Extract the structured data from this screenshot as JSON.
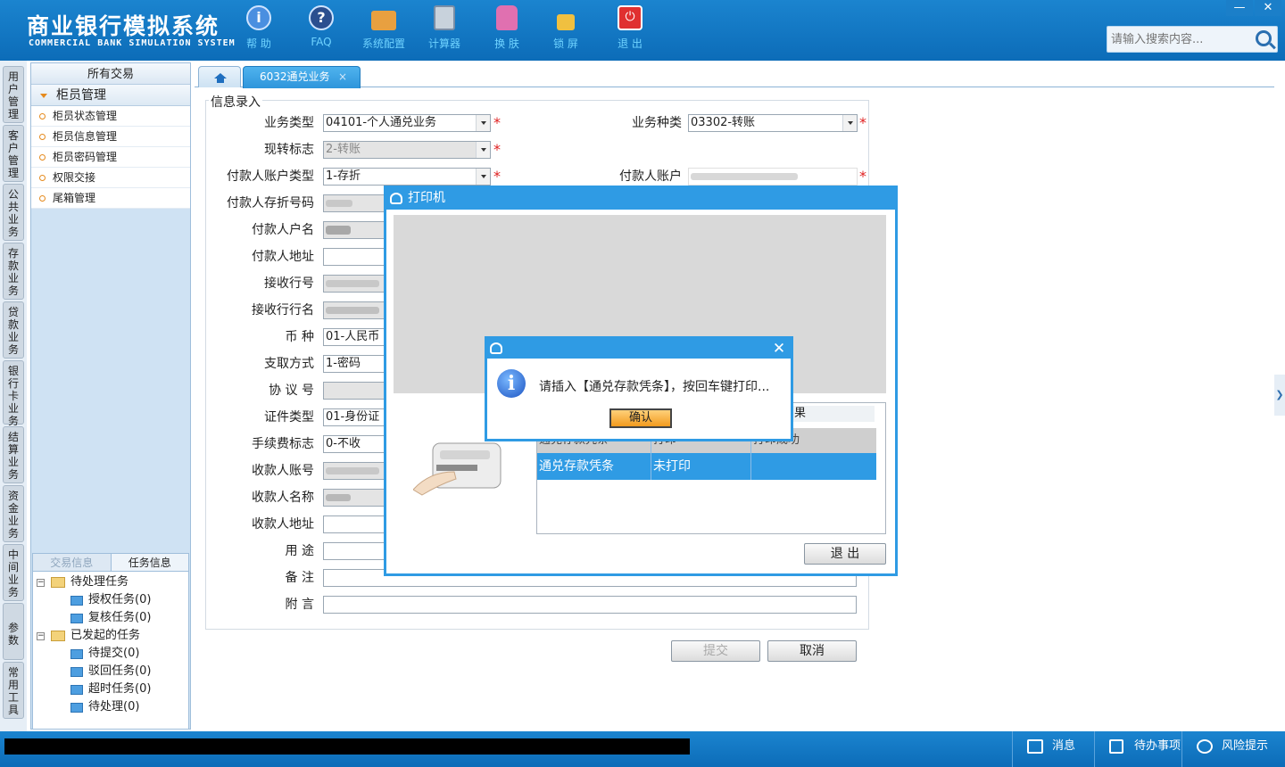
{
  "header": {
    "title_cn": "商业银行模拟系统",
    "title_en": "COMMERCIAL BANK SIMULATION SYSTEM",
    "tools": [
      {
        "label": "帮 助",
        "icon": "help-icon",
        "color": "#4a8fe0"
      },
      {
        "label": "FAQ",
        "icon": "faq-icon",
        "color": "#2b4f8f"
      },
      {
        "label": "系统配置",
        "icon": "toolbox-icon",
        "color": "#e8a040"
      },
      {
        "label": "计算器",
        "icon": "calculator-icon",
        "color": "#7a8ea6"
      },
      {
        "label": "换 肤",
        "icon": "shirt-icon",
        "color": "#e070b0"
      },
      {
        "label": "锁 屏",
        "icon": "lock-icon",
        "color": "#f0c040"
      },
      {
        "label": "退 出",
        "icon": "power-icon",
        "color": "#e03030"
      }
    ],
    "minimize": "—",
    "close": "✕",
    "search_placeholder": "请输入搜索内容..."
  },
  "left_tabs": [
    "用户管理",
    "客户管理",
    "公共业务",
    "存款业务",
    "贷款业务",
    "银行卡业务",
    "结算业务",
    "资金业务",
    "中间业务",
    "参数",
    "常用工具"
  ],
  "nav": {
    "header": "所有交易",
    "group": "柜员管理",
    "items": [
      "柜员状态管理",
      "柜员信息管理",
      "柜员密码管理",
      "权限交接",
      "尾箱管理"
    ]
  },
  "tasks": {
    "tab_trade": "交易信息",
    "tab_task": "任务信息",
    "pending": "待处理任务",
    "pending_children": [
      "授权任务(0)",
      "复核任务(0)"
    ],
    "initiated": "已发起的任务",
    "initiated_children": [
      "待提交(0)",
      "驳回任务(0)",
      "超时任务(0)",
      "待处理(0)"
    ]
  },
  "tabs": {
    "home_icon": "home-icon",
    "active": "6032通兑业务",
    "active_close": "×"
  },
  "form": {
    "legend": "信息录入",
    "biz_type_label": "业务类型",
    "biz_type_value": "04101-个人通兑业务",
    "biz_kind_label": "业务种类",
    "biz_kind_value": "03302-转账",
    "cash_flag_label": "现转标志",
    "cash_flag_value": "2-转账",
    "payer_acct_type_label": "付款人账户类型",
    "payer_acct_type_value": "1-存折",
    "payer_acct_label": "付款人账户",
    "payer_book_no_label": "付款人存折号码",
    "payer_name_label": "付款人户名",
    "payer_addr_label": "付款人地址",
    "recv_bank_no_label": "接收行号",
    "recv_bank_name_label": "接收行行名",
    "currency_label": "币    种",
    "currency_value": "01-人民币",
    "withdraw_label": "支取方式",
    "withdraw_value": "1-密码",
    "agreement_label": "协 议 号",
    "cert_type_label": "证件类型",
    "cert_type_value": "01-身份证",
    "fee_label": "手续费标志",
    "fee_value": "0-不收",
    "payee_acct_label": "收款人账号",
    "payee_name_label": "收款人名称",
    "payee_addr_label": "收款人地址",
    "purpose_label": "用    途",
    "remark_label": "备    注",
    "postscript_label": "附    言",
    "required": "*",
    "submit": "提交",
    "cancel": "取消"
  },
  "printer": {
    "title": "打印机",
    "result_title": "果",
    "col1": "通兑存款凭条",
    "col2": "打印",
    "col3": "打印成功",
    "row_name": "通兑存款凭条",
    "row_status": "未打印",
    "exit": "退  出"
  },
  "message": {
    "text": "请插入【通兑存款凭条】，按回车键打印...",
    "ok": "确认",
    "close": "✕"
  },
  "statusbar": {
    "msg": "消息",
    "todo": "待办事项",
    "risk": "风险提示"
  },
  "colors": {
    "brand": "#1b84cf",
    "accent": "#2f9be4",
    "required": "#e02020"
  }
}
